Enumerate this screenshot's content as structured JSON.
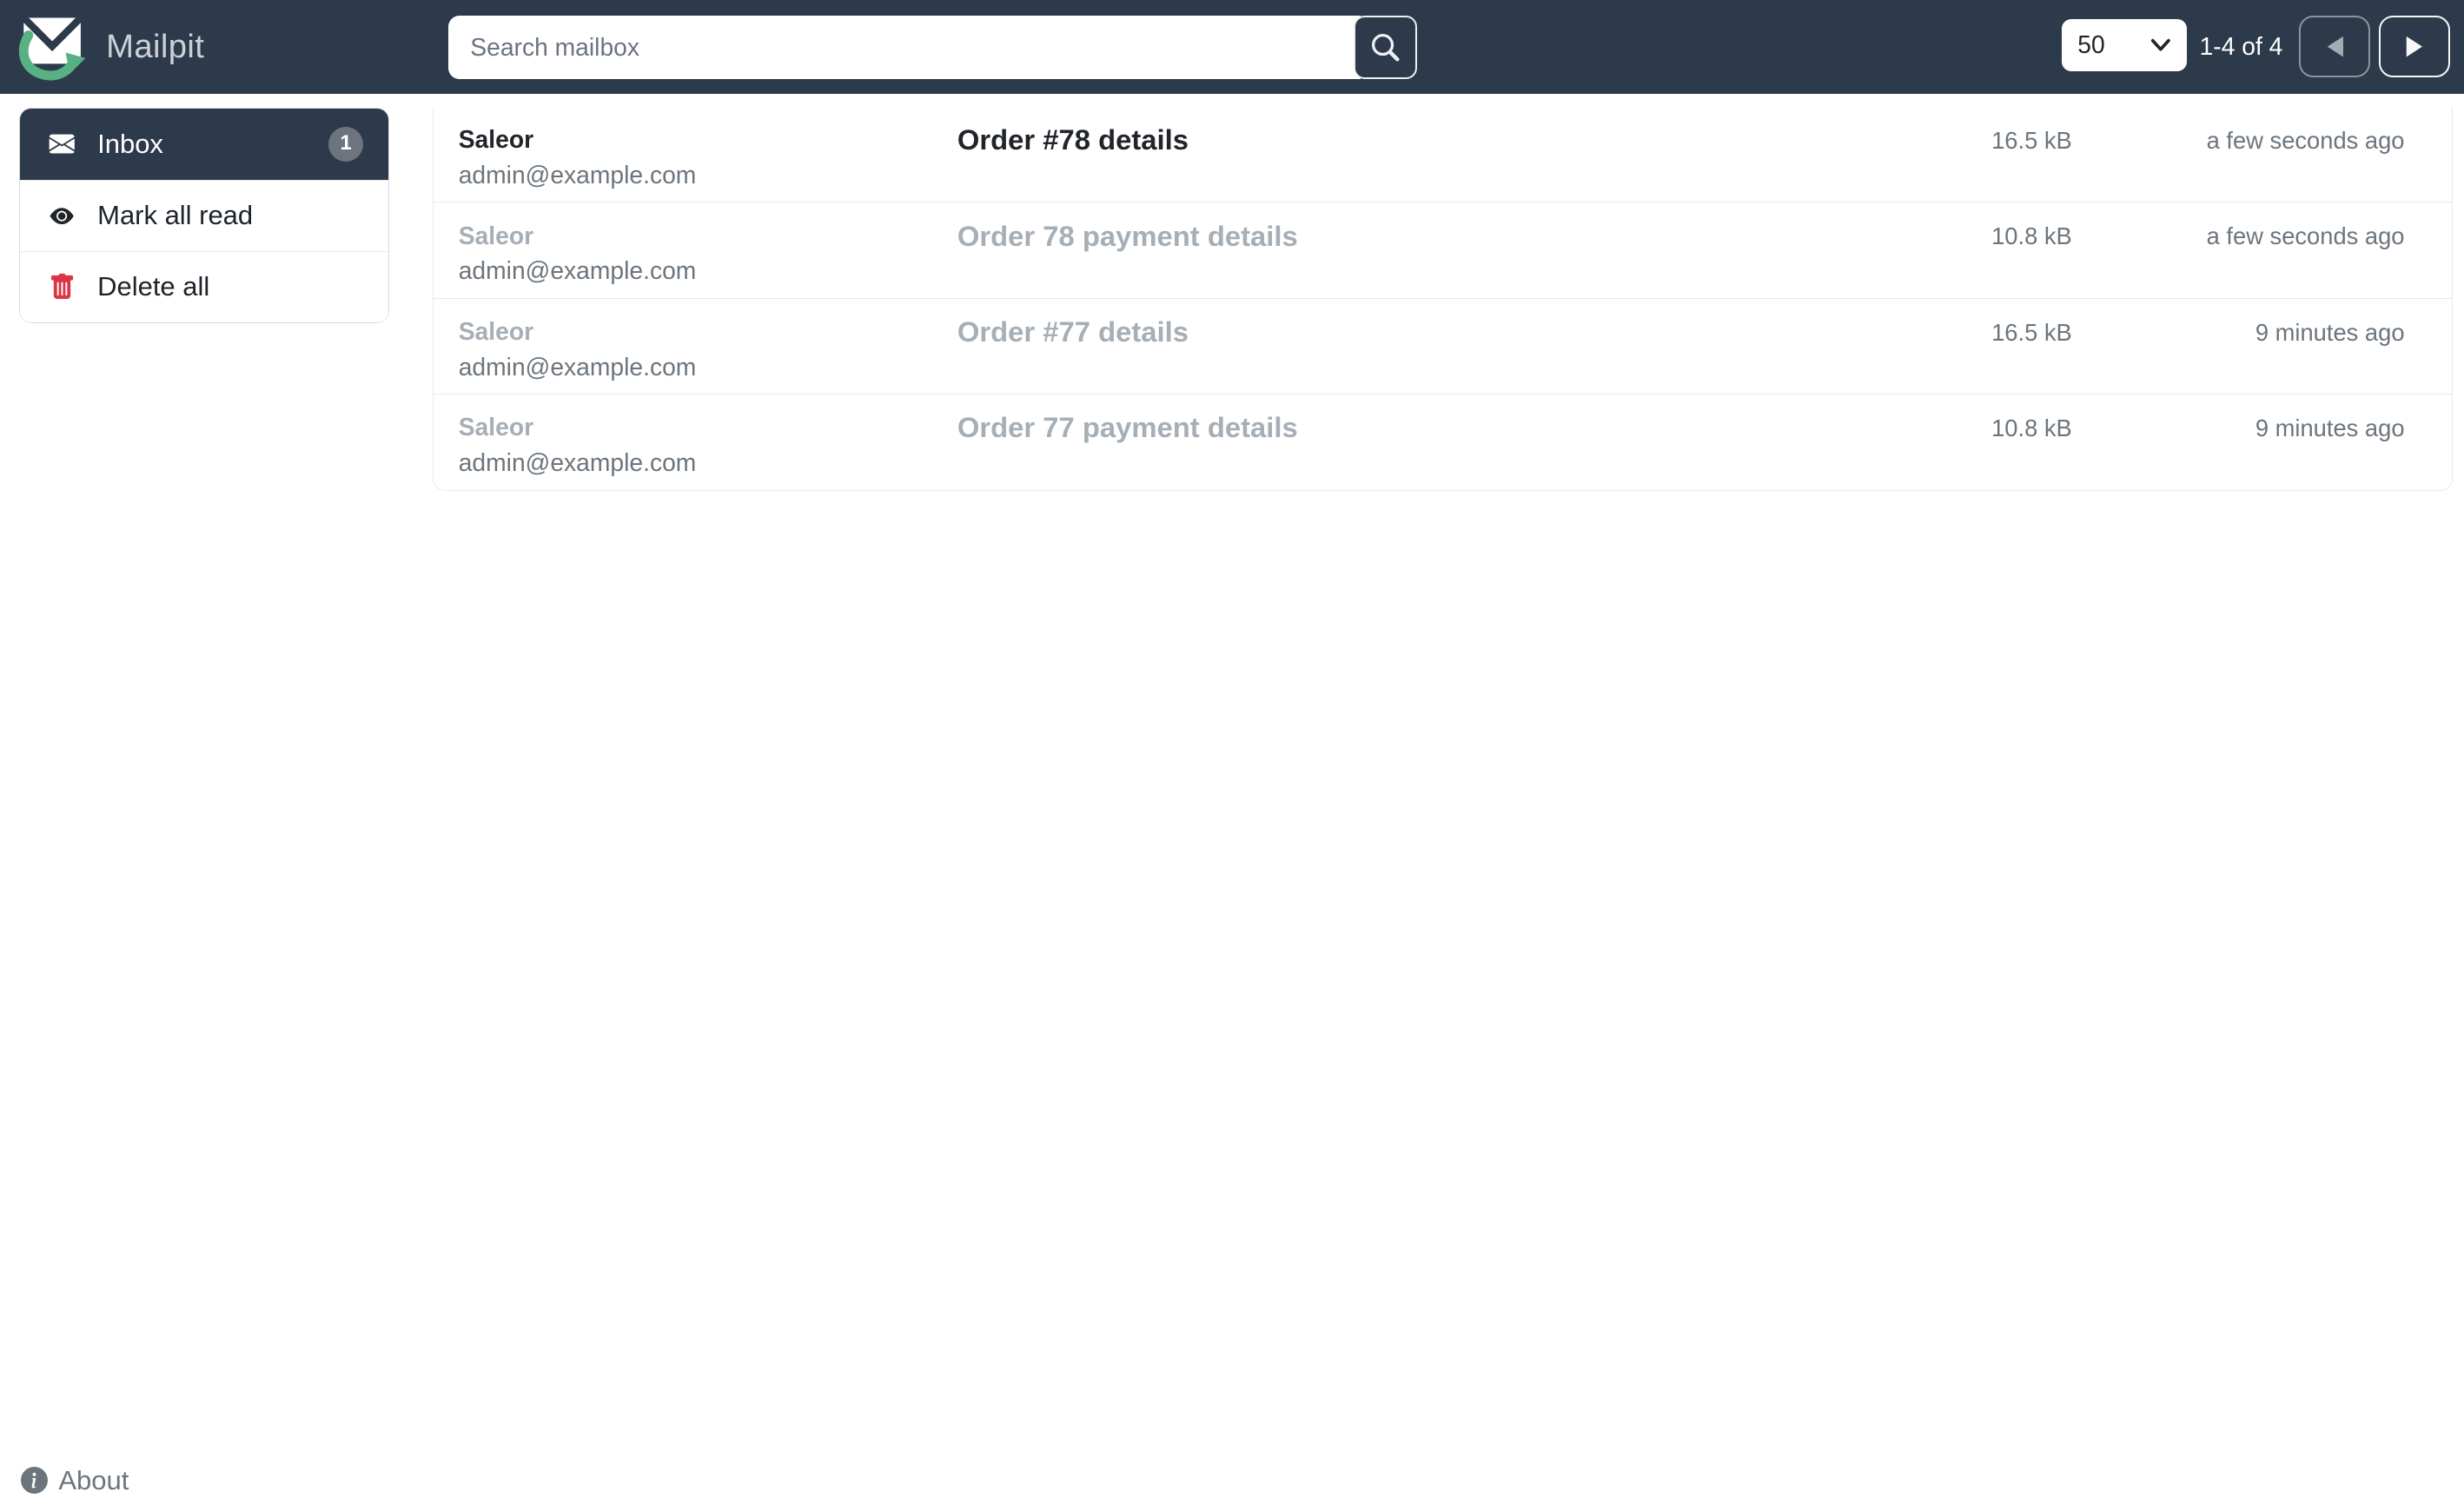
{
  "navbar": {
    "brand": "Mailpit",
    "search": {
      "placeholder": "Search mailbox"
    },
    "per_page": "50",
    "range_label": "1-4 of 4"
  },
  "sidebar": {
    "inbox": {
      "label": "Inbox",
      "unread_count": "1"
    },
    "mark_all_read_label": "Mark all read",
    "delete_all_label": "Delete all"
  },
  "messages": [
    {
      "from_name": "Saleor",
      "from_email": "admin@example.com",
      "subject": "Order #78 details",
      "size": "16.5 kB",
      "time": "a few seconds ago",
      "read": false
    },
    {
      "from_name": "Saleor",
      "from_email": "admin@example.com",
      "subject": "Order 78 payment details",
      "size": "10.8 kB",
      "time": "a few seconds ago",
      "read": true
    },
    {
      "from_name": "Saleor",
      "from_email": "admin@example.com",
      "subject": "Order #77 details",
      "size": "16.5 kB",
      "time": "9 minutes ago",
      "read": true
    },
    {
      "from_name": "Saleor",
      "from_email": "admin@example.com",
      "subject": "Order 77 payment details",
      "size": "10.8 kB",
      "time": "9 minutes ago",
      "read": true
    }
  ],
  "footer": {
    "about_label": "About"
  },
  "icons": {
    "logo": "mailpit-envelope-arrow-logo",
    "search": "magnifier-icon",
    "per_page": "chevron-down-icon",
    "prev": "triangle-left-icon",
    "next": "triangle-right-icon",
    "inbox": "envelope-icon",
    "mark_read": "eye-icon",
    "delete": "trash-icon",
    "about": "info-circle-icon"
  },
  "colors": {
    "navbar_bg": "#2d3a4b",
    "active_item_bg": "#2d3a4b",
    "logo_green": "#57b183",
    "badge_bg": "#6c757d",
    "danger_red": "#dc3545",
    "unread_text": "#212529",
    "read_text": "#a6aeb6",
    "muted_text": "#6c757d",
    "separator": "#e5e8ea"
  }
}
